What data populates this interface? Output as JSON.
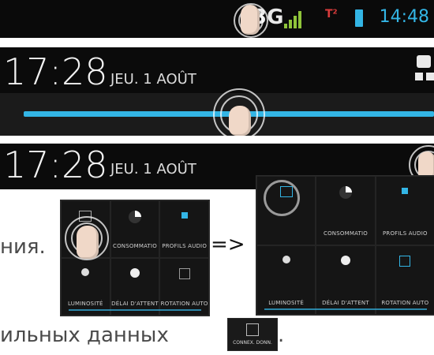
{
  "status_bar": {
    "network_label": "3G",
    "time": "14:48"
  },
  "panel1": {
    "time": "17:28",
    "date": "JEU. 1 AOÛT"
  },
  "panel2": {
    "time": "17:28",
    "date": "JEU. 1 AOÛT"
  },
  "grid_left": {
    "tiles": [
      {
        "label": "",
        "icon": "data-icon"
      },
      {
        "label": "CONSOMMATIO",
        "icon": "pie-icon"
      },
      {
        "label": "PROFILS AUDIO",
        "icon": "audio-icon"
      },
      {
        "label": "LUMINOSITÉ",
        "icon": "brightness-icon"
      },
      {
        "label": "DÉLAI D'ATTENT",
        "icon": "timer-icon"
      },
      {
        "label": "ROTATION AUTO",
        "icon": "rotate-icon"
      }
    ]
  },
  "grid_right": {
    "tiles": [
      {
        "label": "",
        "icon": "data-icon"
      },
      {
        "label": "CONSOMMATIO",
        "icon": "pie-icon"
      },
      {
        "label": "PROFILS AUDIO",
        "icon": "audio-icon"
      },
      {
        "label": "LUMINOSITÉ",
        "icon": "brightness-icon"
      },
      {
        "label": "DÉLAI D'ATTENT",
        "icon": "timer-icon"
      },
      {
        "label": "ROTATION AUTO",
        "icon": "rotate-icon"
      }
    ]
  },
  "text_line1": "ния.",
  "arrow": "=>",
  "text_line2": "ильных данных",
  "text_line2_end": ".",
  "chip_label": "CONNEX. DONN.",
  "colors": {
    "accent": "#33b5e5",
    "signal": "#8fc43a",
    "dark": "#0b0b0b"
  }
}
